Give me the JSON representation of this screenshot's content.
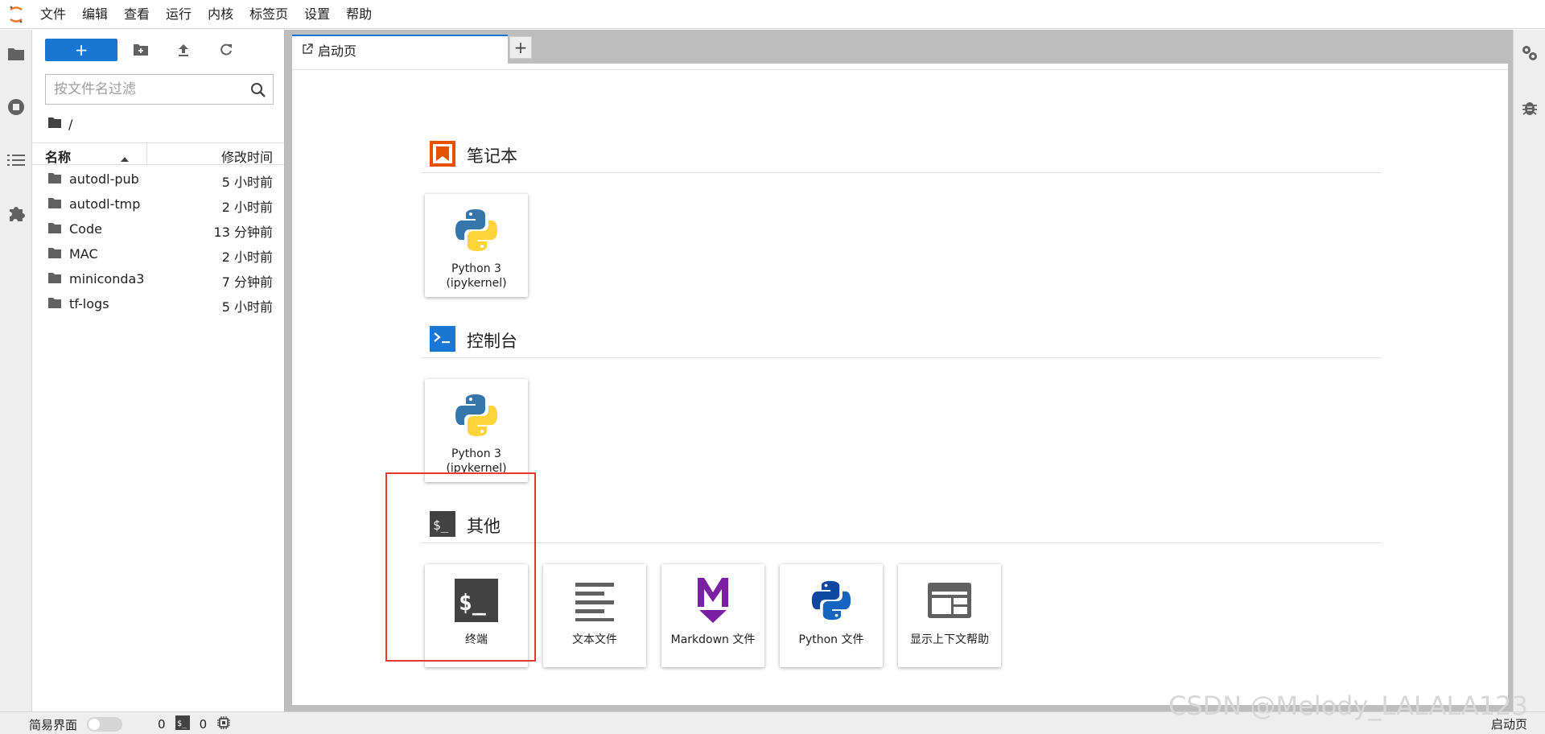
{
  "menubar": {
    "items": [
      "文件",
      "编辑",
      "查看",
      "运行",
      "内核",
      "标签页",
      "设置",
      "帮助"
    ]
  },
  "toolbar": {
    "new_label": "+"
  },
  "filter": {
    "placeholder": "按文件名过滤"
  },
  "breadcrumb": {
    "path": "/"
  },
  "file_list": {
    "col_name": "名称",
    "col_modified": "修改时间",
    "rows": [
      {
        "name": "autodl-pub",
        "modified": "5 小时前"
      },
      {
        "name": "autodl-tmp",
        "modified": "2 小时前"
      },
      {
        "name": "Code",
        "modified": "13 分钟前"
      },
      {
        "name": "MAC",
        "modified": "2 小时前"
      },
      {
        "name": "miniconda3",
        "modified": "7 分钟前"
      },
      {
        "name": "tf-logs",
        "modified": "5 小时前"
      }
    ]
  },
  "tabs": {
    "launcher_label": "启动页",
    "add_label": "+"
  },
  "launcher": {
    "notebook": {
      "title": "笔记本",
      "cards": [
        {
          "label_line1": "Python 3",
          "label_line2": "(ipykernel)"
        }
      ]
    },
    "console": {
      "title": "控制台",
      "cards": [
        {
          "label_line1": "Python 3",
          "label_line2": "(ipykernel)"
        }
      ]
    },
    "other": {
      "title": "其他",
      "cards": [
        {
          "label": "终端",
          "icon": "terminal-icon"
        },
        {
          "label": "文本文件",
          "icon": "text-file-icon"
        },
        {
          "label": "Markdown 文件",
          "icon": "markdown-icon"
        },
        {
          "label": "Python 文件",
          "icon": "python-file-icon"
        },
        {
          "label": "显示上下文帮助",
          "icon": "context-help-icon"
        }
      ]
    }
  },
  "statusbar": {
    "simple_mode_label": "简易界面",
    "kernel_count": "0",
    "terminal_count": "0",
    "active_tab": "启动页"
  },
  "watermark": "CSDN @Melody_LALALA123",
  "colors": {
    "accent": "#1976d2",
    "highlight_border": "#e53935",
    "notebook_icon": "#e65100",
    "console_icon": "#1976d2",
    "markdown_icon": "#7b1fa2"
  }
}
